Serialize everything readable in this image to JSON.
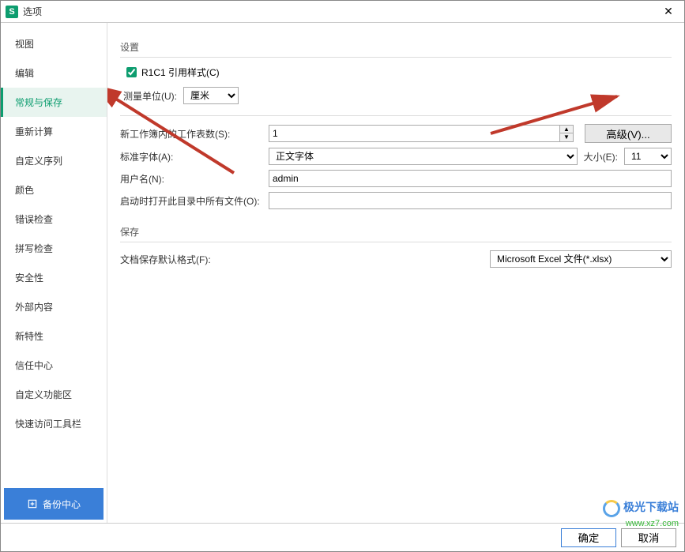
{
  "titlebar": {
    "title": "选项"
  },
  "sidebar": {
    "items": [
      "视图",
      "编辑",
      "常规与保存",
      "重新计算",
      "自定义序列",
      "颜色",
      "错误检查",
      "拼写检查",
      "安全性",
      "外部内容",
      "新特性",
      "信任中心",
      "自定义功能区",
      "快速访问工具栏"
    ],
    "active_index": 2,
    "backup": "备份中心"
  },
  "settings": {
    "head": "设置",
    "r1c1_label": "R1C1 引用样式(C)",
    "r1c1_checked": true,
    "unit_label": "测量单位(U):",
    "unit_value": "厘米",
    "sheets_label": "新工作簿内的工作表数(S):",
    "sheets_value": "1",
    "advanced_btn": "高级(V)...",
    "font_label": "标准字体(A):",
    "font_value": "正文字体",
    "size_label": "大小(E):",
    "size_value": "11",
    "user_label": "用户名(N):",
    "user_value": "admin",
    "open_label": "启动时打开此目录中所有文件(O):",
    "open_value": ""
  },
  "save": {
    "head": "保存",
    "format_label": "文档保存默认格式(F):",
    "format_value": "Microsoft Excel 文件(*.xlsx)"
  },
  "footer": {
    "ok": "确定",
    "cancel": "取消"
  },
  "watermark": {
    "line1": "极光下载站",
    "line2": "www.xz7.com"
  }
}
